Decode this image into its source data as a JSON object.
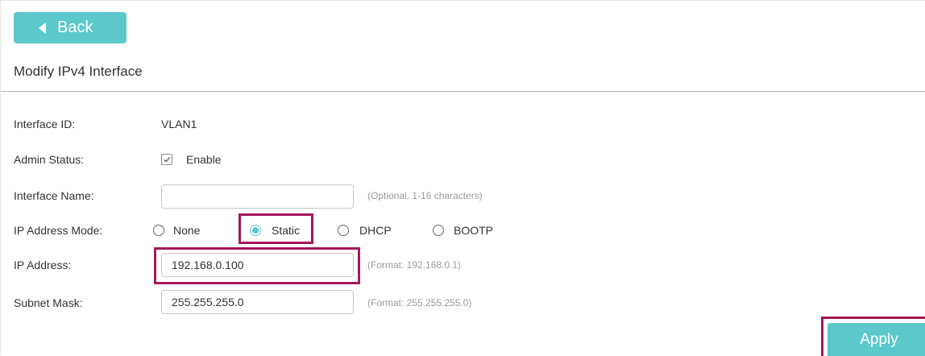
{
  "header": {
    "back_label": "Back",
    "title": "Modify IPv4 Interface"
  },
  "form": {
    "interface_id": {
      "label": "Interface ID:",
      "value": "VLAN1"
    },
    "admin_status": {
      "label": "Admin Status:",
      "checkbox_label": "Enable",
      "checked": true
    },
    "interface_name": {
      "label": "Interface Name:",
      "value": "",
      "hint": "(Optional. 1-16 characters)"
    },
    "ip_address_mode": {
      "label": "IP Address Mode:",
      "options": [
        "None",
        "Static",
        "DHCP",
        "BOOTP"
      ],
      "selected": "Static"
    },
    "ip_address": {
      "label": "IP Address:",
      "value": "192.168.0.100",
      "hint": "(Format: 192.168.0.1)"
    },
    "subnet_mask": {
      "label": "Subnet Mask:",
      "value": "255.255.255.0",
      "hint": "(Format: 255.255.255.0)"
    }
  },
  "footer": {
    "apply_label": "Apply"
  },
  "colors": {
    "accent": "#5bc8cc",
    "highlight": "#a4175a"
  }
}
